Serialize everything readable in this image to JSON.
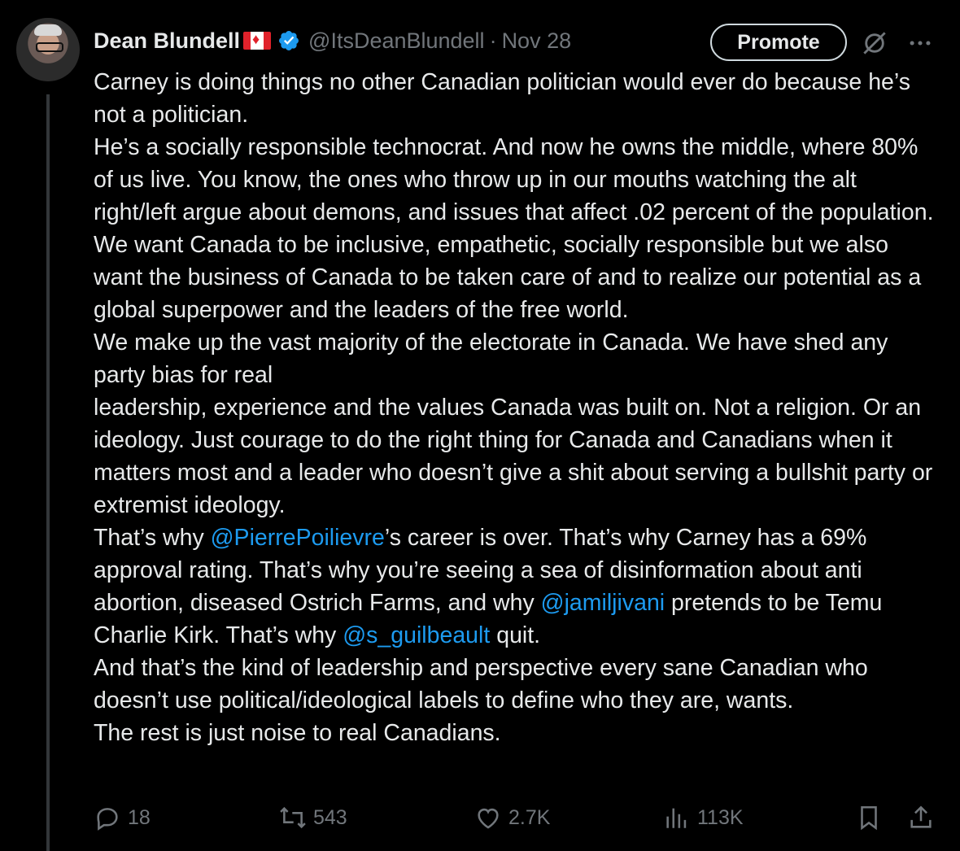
{
  "author": {
    "name": "Dean Blundell",
    "handle": "@ItsDeanBlundell",
    "separator": "·",
    "date": "Nov 28"
  },
  "header": {
    "promote_label": "Promote"
  },
  "tweet": {
    "lines": [
      [
        {
          "t": "Carney is doing things no other Canadian politician would ever do because he’s not a politician."
        }
      ],
      [
        {
          "t": "He’s a socially responsible technocrat.  And now he owns the middle, where 80% of us live. You know, the ones who throw up in our mouths watching the alt right/left argue about demons, and issues that affect .02 percent of the population."
        }
      ],
      [
        {
          "t": "We want Canada to be inclusive, empathetic, socially responsible but we also want the business of Canada to be taken care of and to realize our potential as a global superpower and the leaders of the free world."
        }
      ],
      [
        {
          "t": "We make up the vast majority of the electorate in Canada. We have shed any party bias for real"
        }
      ],
      [
        {
          "t": "leadership, experience and the values Canada was built on. Not a religion. Or an ideology.  Just courage to do the right thing for Canada and Canadians when it matters most and a leader who doesn’t give a shit about serving a bullshit party or extremist ideology."
        }
      ],
      [
        {
          "t": "That’s why "
        },
        {
          "t": "@PierrePoilievre",
          "m": true
        },
        {
          "t": "’s career is over. That’s why Carney has a 69% approval rating.  That’s why you’re seeing a sea of disinformation about anti abortion, diseased Ostrich Farms, and why "
        },
        {
          "t": "@jamiljivani",
          "m": true
        },
        {
          "t": " pretends to be Temu Charlie Kirk. That’s why "
        },
        {
          "t": "@s_guilbeault",
          "m": true
        },
        {
          "t": " quit."
        }
      ],
      [
        {
          "t": "And that’s the kind of leadership and perspective every sane Canadian who doesn’t use political/ideological labels to define who they are, wants."
        }
      ],
      [
        {
          "t": "The rest is just noise to real Canadians."
        }
      ]
    ]
  },
  "actions": {
    "replies": "18",
    "reposts": "543",
    "likes": "2.7K",
    "views": "113K"
  },
  "colors": {
    "background": "#000000",
    "text": "#e7e9ea",
    "muted": "#71767b",
    "accent": "#1d9bf0"
  },
  "icons": [
    "verified-badge-icon",
    "flag-canada-icon",
    "grok-icon",
    "more-icon",
    "reply-icon",
    "repost-icon",
    "like-icon",
    "views-icon",
    "bookmark-icon",
    "share-icon"
  ]
}
